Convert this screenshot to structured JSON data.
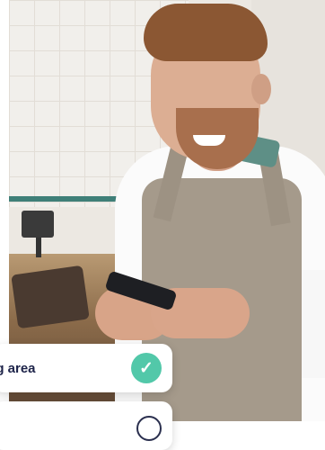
{
  "photo": {
    "alt_subject": "",
    "accent_colors": {
      "apron": "#a59a8b",
      "shirt": "#fbfbfb",
      "tile": "#f1efeb"
    }
  },
  "checklist": {
    "items": [
      {
        "label": "ing area",
        "state": "checked",
        "icon": "check-icon"
      },
      {
        "label": "",
        "state": "unchecked",
        "icon": "empty-circle-icon"
      }
    ],
    "colors": {
      "check_fill": "#52c8a9",
      "label_text": "#1d2349"
    }
  }
}
